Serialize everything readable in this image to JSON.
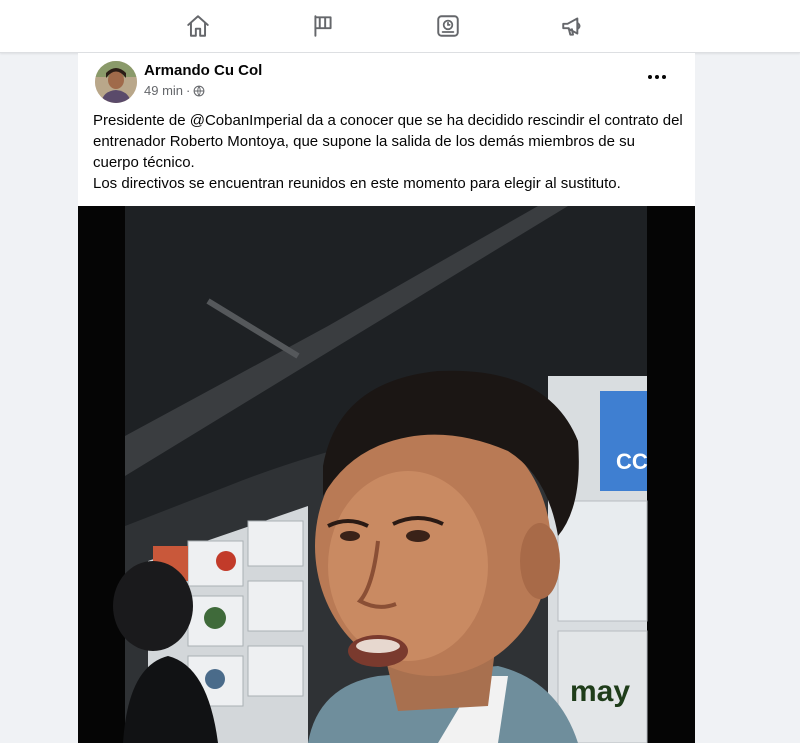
{
  "nav": {
    "items": [
      {
        "name": "home",
        "icon": "home-icon"
      },
      {
        "name": "pages",
        "icon": "flag-icon"
      },
      {
        "name": "marketplace",
        "icon": "storefront-icon"
      },
      {
        "name": "ads",
        "icon": "megaphone-icon"
      }
    ],
    "icon_color": "#65676b"
  },
  "post": {
    "author": "Armando Cu Col",
    "time": "49 min",
    "separator": "·",
    "privacy_icon": "globe-icon",
    "more_icon": "more-options-icon",
    "text_line_1": "Presidente de @CobanImperial da a conocer que se ha decidido rescindir el contrato del entrenador Roberto Montoya, que supone la salida de los demás miembros de su cuerpo técnico.",
    "text_line_2": "Los directivos se encuentran reunidos en este momento para elegir al sustituto.",
    "media_type": "video",
    "backdrop_text_1": "CC",
    "backdrop_text_2": "may"
  },
  "colors": {
    "background": "#f0f2f5",
    "card": "#ffffff",
    "secondary_text": "#65676b",
    "brand_blue": "#1877f2"
  }
}
